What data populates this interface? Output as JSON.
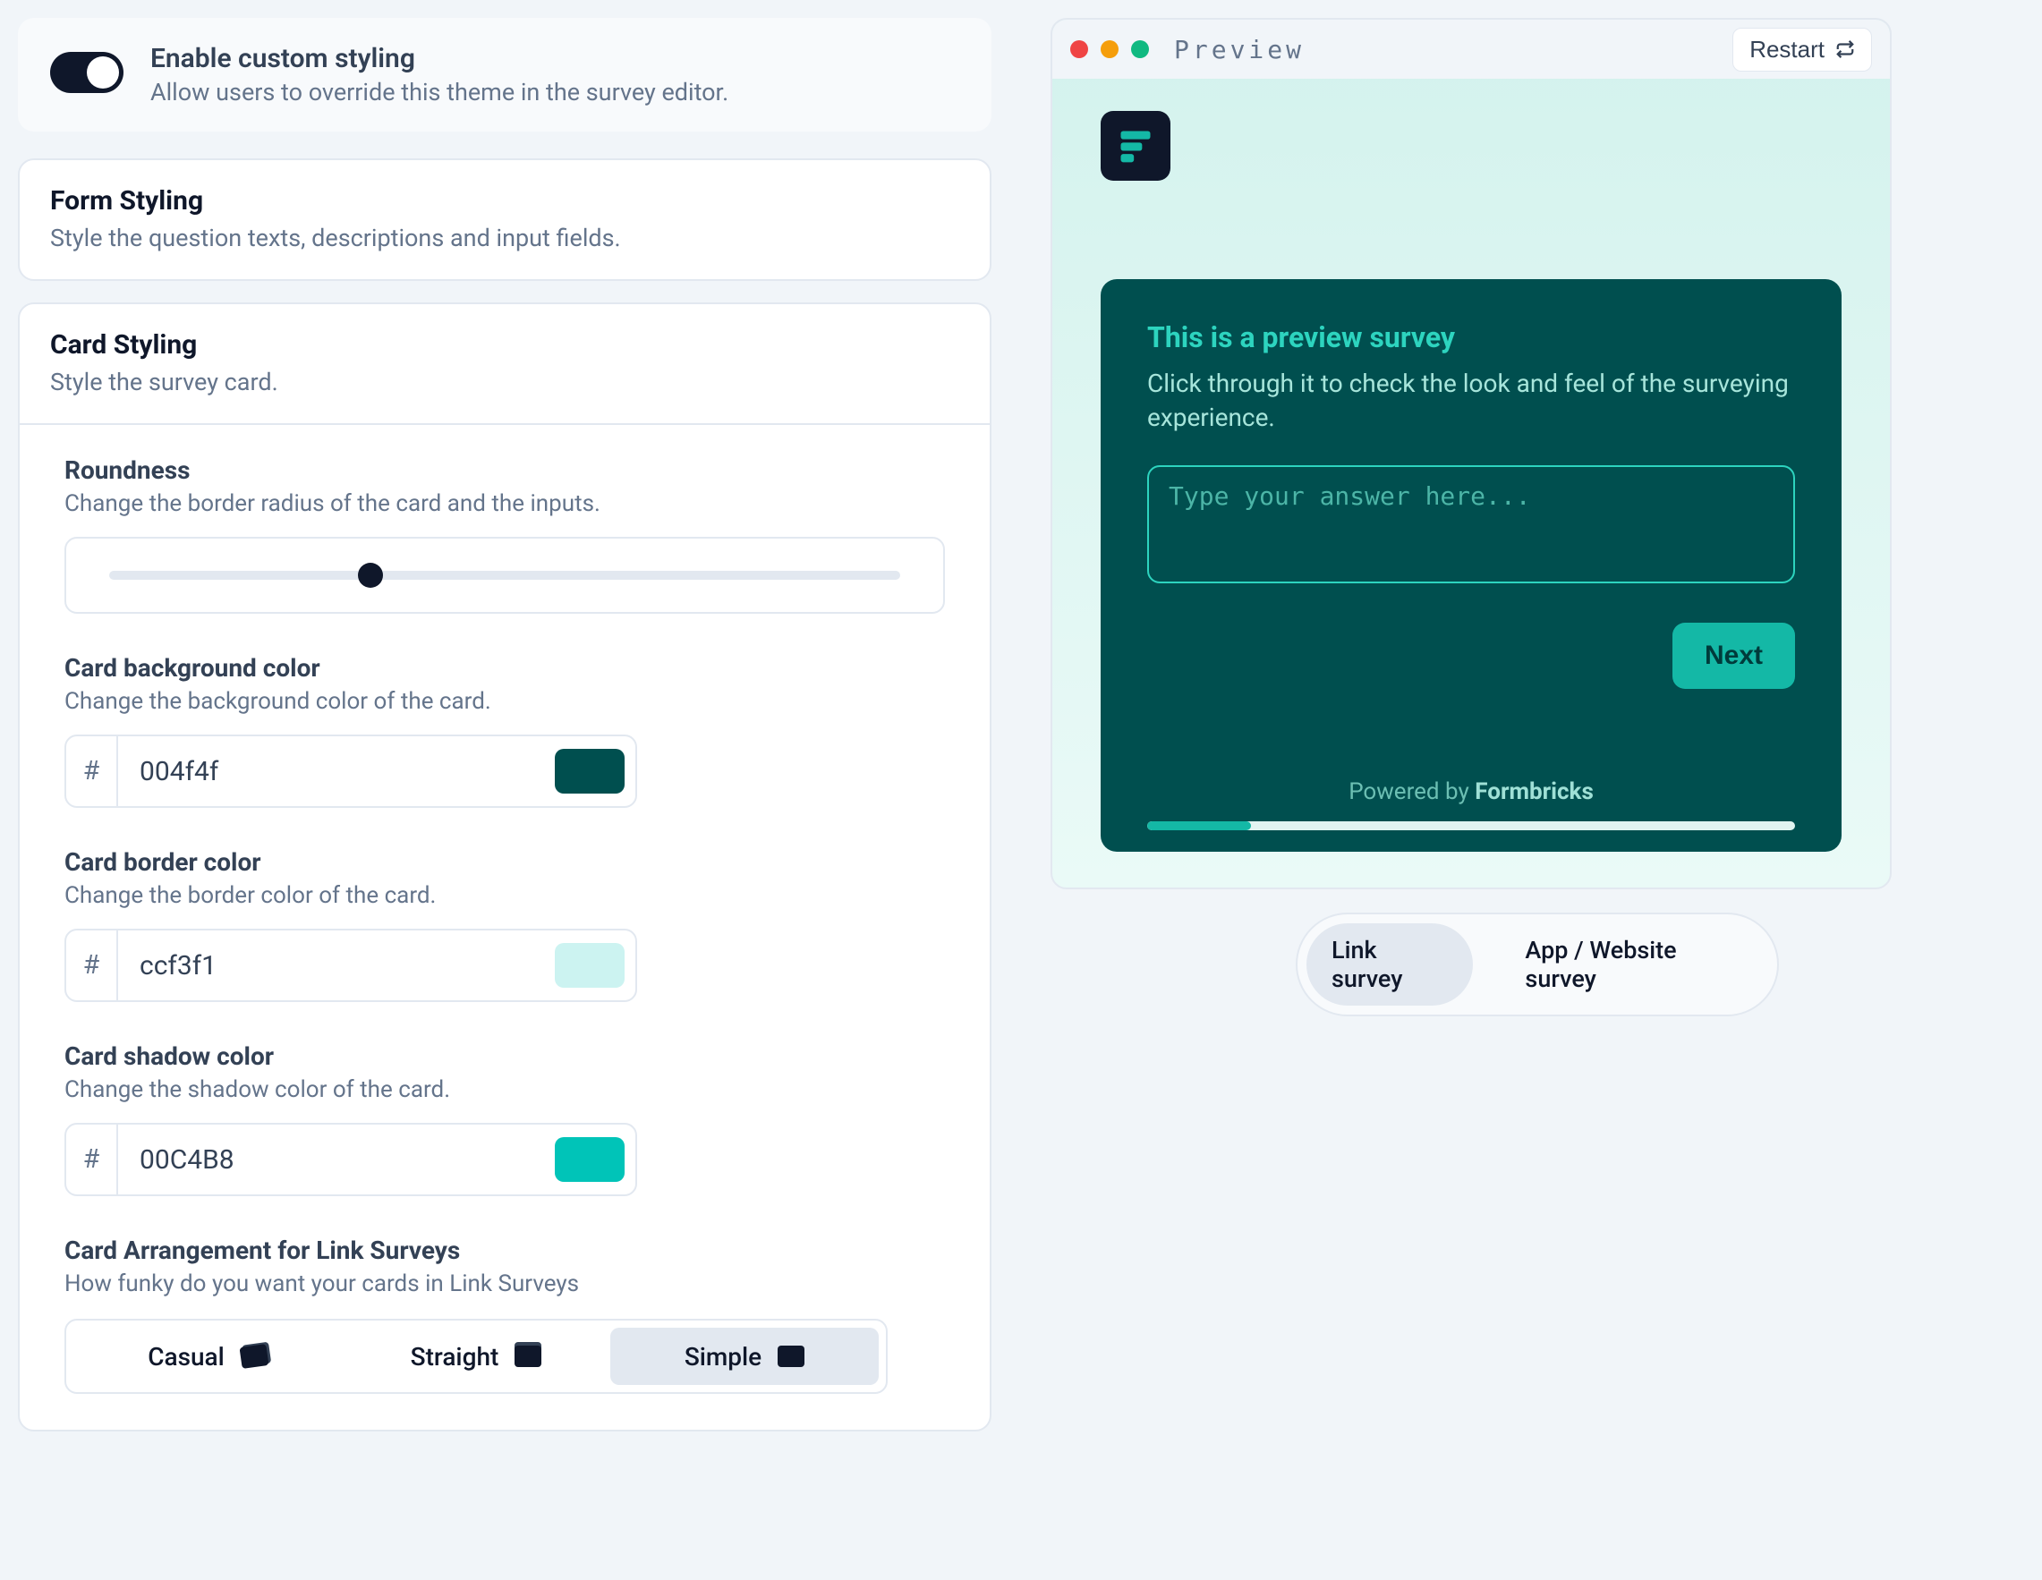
{
  "enable": {
    "title": "Enable custom styling",
    "desc": "Allow users to override this theme in the survey editor."
  },
  "formStyling": {
    "title": "Form Styling",
    "desc": "Style the question texts, descriptions and input fields."
  },
  "cardStyling": {
    "title": "Card Styling",
    "desc": "Style the survey card."
  },
  "roundness": {
    "title": "Roundness",
    "desc": "Change the border radius of the card and the inputs."
  },
  "cardBg": {
    "title": "Card background color",
    "desc": "Change the background color of the card.",
    "hex": "004f4f",
    "swatch": "#004f4f"
  },
  "cardBorder": {
    "title": "Card border color",
    "desc": "Change the border color of the card.",
    "hex": "ccf3f1",
    "swatch": "#ccf3f1"
  },
  "cardShadow": {
    "title": "Card shadow color",
    "desc": "Change the shadow color of the card.",
    "hex": "00C4B8",
    "swatch": "#00C4B8"
  },
  "arrangement": {
    "title": "Card Arrangement for Link Surveys",
    "desc": "How funky do you want your cards in Link Surveys",
    "options": {
      "casual": "Casual",
      "straight": "Straight",
      "simple": "Simple"
    }
  },
  "preview": {
    "label": "Preview",
    "restart": "Restart",
    "surveyTitle": "This is a preview survey",
    "surveyDesc": "Click through it to check the look and feel of the surveying experience.",
    "placeholder": "Type your answer here...",
    "next": "Next",
    "poweredPrefix": "Powered by ",
    "poweredBrand": "Formbricks"
  },
  "modes": {
    "link": "Link survey",
    "app": "App / Website survey"
  }
}
